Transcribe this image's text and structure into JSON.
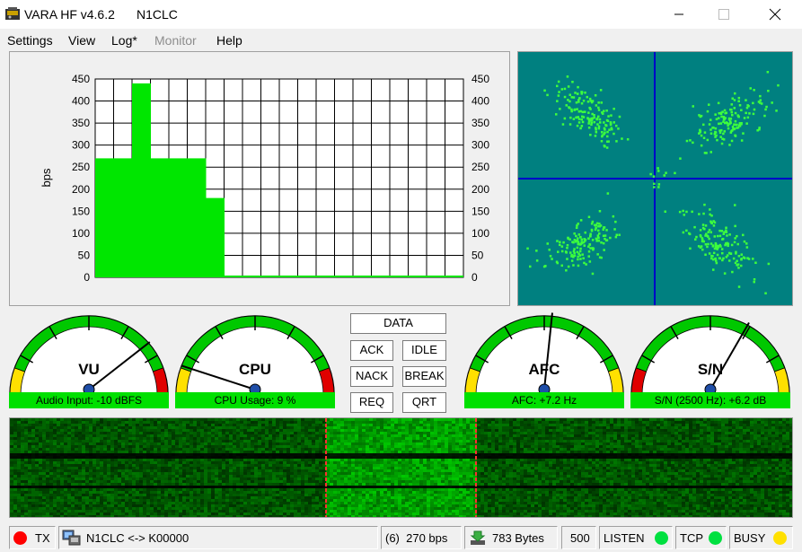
{
  "window": {
    "title": "VARA HF v4.6.2",
    "callsign": "N1CLC"
  },
  "menu": {
    "items": [
      "Settings",
      "View",
      "Log*",
      "Monitor",
      "Help"
    ]
  },
  "chart_data": {
    "type": "bar",
    "ylabel": "bps",
    "ylim": [
      0,
      450
    ],
    "y_ticks": [
      "450",
      "400",
      "350",
      "300",
      "250",
      "200",
      "150",
      "100",
      "50",
      "0"
    ],
    "values": [
      270,
      270,
      440,
      270,
      270,
      270,
      180,
      0,
      0,
      0,
      0,
      0,
      0,
      0,
      0,
      0,
      0,
      0,
      0,
      0
    ],
    "bar_color": "#00e600",
    "grid": true
  },
  "buttons": {
    "data": "DATA",
    "ack": "ACK",
    "idle": "IDLE",
    "nack": "NACK",
    "break": "BREAK",
    "req": "REQ",
    "qrt": "QRT"
  },
  "gauges": {
    "vu": {
      "name": "VU",
      "label": "Audio Input: -10 dBFS"
    },
    "cpu": {
      "name": "CPU",
      "label": "CPU Usage: 9 %"
    },
    "afc": {
      "name": "AFC",
      "label": "AFC: +7.2 Hz"
    },
    "sn": {
      "name": "S/N",
      "label": "S/N (2500 Hz): +6.2 dB"
    }
  },
  "status": {
    "tx": "TX",
    "link": "N1CLC <-> K00000",
    "speed": "(6)  270 bps",
    "bytes": "783 Bytes",
    "bw": "500",
    "listen": "LISTEN",
    "tcp": "TCP",
    "busy": "BUSY"
  },
  "colors": {
    "constellation_bg": "#008080",
    "points": "#3dff3d",
    "gauge_green": "#00e000",
    "led_red": "#ff0000",
    "led_green": "#00e040",
    "led_yellow": "#ffe000"
  }
}
